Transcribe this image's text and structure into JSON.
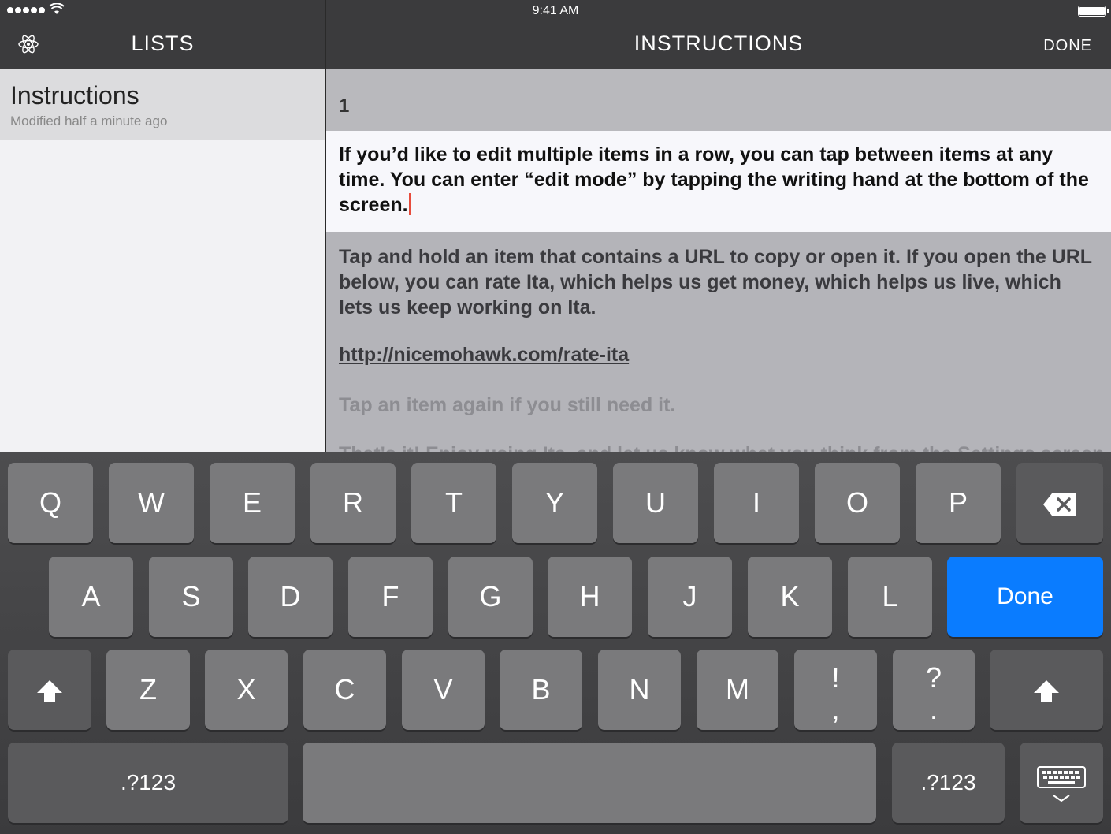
{
  "status_bar": {
    "time": "9:41 AM"
  },
  "nav": {
    "left_title": "LISTS",
    "main_title": "INSTRUCTIONS",
    "done_label": "DONE"
  },
  "sidebar": {
    "items": [
      {
        "title": "Instructions",
        "subtitle": "Modified half a minute ago"
      }
    ]
  },
  "content": {
    "row_number": "1",
    "edit_text": "If you’d like to edit multiple items in a row, you can tap between items at any time. You can enter “edit mode” by tapping the writing hand at the bottom of the screen.",
    "body_text": "Tap and hold an item that contains a URL to copy or open it. If you open the URL below, you can rate Ita, which helps us get money, which helps us live, which lets us keep working on Ita.",
    "link": "http://nicemohawk.com/rate-ita",
    "hint": "Tap an item again if you still need it.",
    "cut_text": "That's it! Enjoy using Ita, and let us know what you think from the Settings screen — tap"
  },
  "keyboard": {
    "row1": [
      "Q",
      "W",
      "E",
      "R",
      "T",
      "Y",
      "U",
      "I",
      "O",
      "P"
    ],
    "row2": [
      "A",
      "S",
      "D",
      "F",
      "G",
      "H",
      "J",
      "K",
      "L"
    ],
    "done": "Done",
    "row3": [
      "Z",
      "X",
      "C",
      "V",
      "B",
      "N",
      "M"
    ],
    "exclaim_top": "!",
    "exclaim_bottom": ",",
    "question_top": "?",
    "question_bottom": ".",
    "numbers_label": ".?123",
    "accent_color": "#0a7cff"
  }
}
